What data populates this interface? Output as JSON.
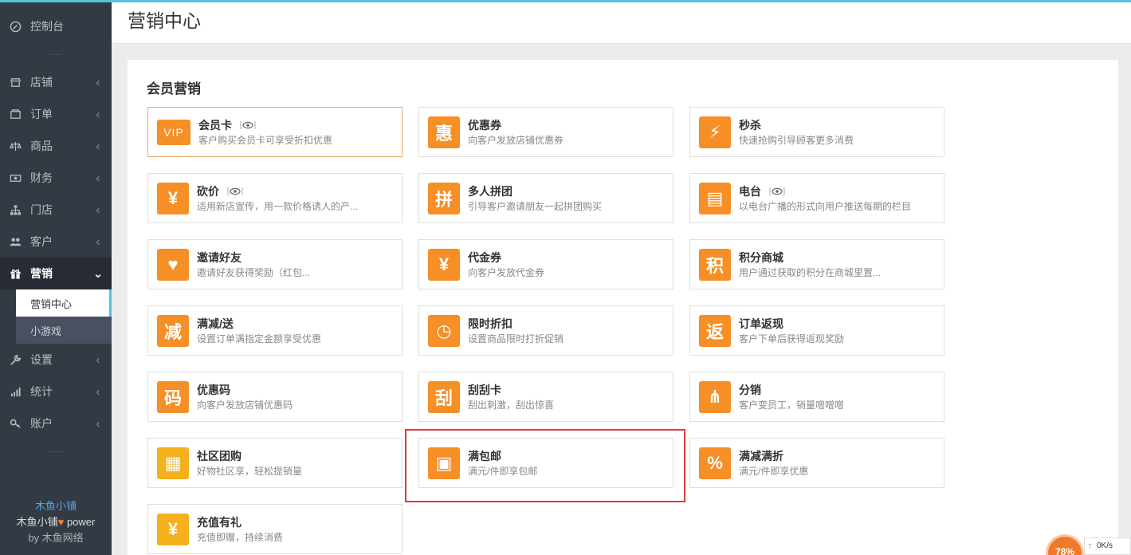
{
  "sidebar": {
    "top_item": {
      "label": "控制台",
      "icon": "dashboard-icon"
    },
    "items": [
      {
        "label": "店铺",
        "icon": "shop-icon"
      },
      {
        "label": "订单",
        "icon": "order-icon"
      },
      {
        "label": "商品",
        "icon": "scale-icon"
      },
      {
        "label": "财务",
        "icon": "money-icon"
      },
      {
        "label": "门店",
        "icon": "sitemap-icon"
      },
      {
        "label": "客户",
        "icon": "users-icon"
      },
      {
        "label": "营销",
        "icon": "gift-icon"
      },
      {
        "label": "设置",
        "icon": "wrench-icon"
      },
      {
        "label": "统计",
        "icon": "bar-chart-icon"
      },
      {
        "label": "账户",
        "icon": "key-icon"
      }
    ],
    "submenu": [
      {
        "label": "营销中心"
      },
      {
        "label": "小游戏"
      }
    ],
    "dots": "....",
    "brand": {
      "name": "木鱼小铺",
      "power_prefix": "木鱼小铺",
      "power_suffix": " power",
      "by": "by 木鱼网络"
    }
  },
  "header": {
    "title": "营销中心"
  },
  "section": {
    "title": "会员营销"
  },
  "cards": [
    {
      "title": "会员卡",
      "desc": "客户购买会员卡可享受折扣优惠",
      "icon": "vip-icon",
      "glyph": "VIP",
      "eye": true
    },
    {
      "title": "优惠券",
      "desc": "向客户发放店铺优惠券",
      "icon": "hui-icon",
      "glyph": "惠",
      "eye": false
    },
    {
      "title": "秒杀",
      "desc": "快速抢购引导顾客更多消费",
      "icon": "lightning-icon",
      "glyph": "⚡",
      "eye": false
    },
    {
      "title": "砍价",
      "desc": "适用新店宣传，用一款价格诱人的产...",
      "icon": "bargain-icon",
      "glyph": "¥",
      "eye": true
    },
    {
      "title": "多人拼团",
      "desc": "引导客户邀请朋友一起拼团购买",
      "icon": "group-buy-icon",
      "glyph": "拼",
      "eye": false
    },
    {
      "title": "电台",
      "desc": "以电台广播的形式向用户推送每期的栏目",
      "icon": "radio-icon",
      "glyph": "▤",
      "eye": true
    },
    {
      "title": "邀请好友",
      "desc": "邀请好友获得奖励（红包...",
      "icon": "invite-icon",
      "glyph": "♥",
      "eye": false
    },
    {
      "title": "代金券",
      "desc": "向客户发放代金券",
      "icon": "voucher-icon",
      "glyph": "¥",
      "eye": false
    },
    {
      "title": "积分商城",
      "desc": "用户通过获取的积分在商城里置...",
      "icon": "points-icon",
      "glyph": "积",
      "eye": false
    },
    {
      "title": "满减/送",
      "desc": "设置订单满指定金额享受优惠",
      "icon": "minus-icon",
      "glyph": "减",
      "eye": false
    },
    {
      "title": "限时折扣",
      "desc": "设置商品限时打折促销",
      "icon": "clock-icon",
      "glyph": "◷",
      "eye": false
    },
    {
      "title": "订单返现",
      "desc": "客户下单后获得返现奖励",
      "icon": "cashback-icon",
      "glyph": "返",
      "eye": false
    },
    {
      "title": "优惠码",
      "desc": "向客户发放店铺优惠码",
      "icon": "code-icon",
      "glyph": "码",
      "eye": false
    },
    {
      "title": "刮刮卡",
      "desc": "刮出刺激，刮出惊喜",
      "icon": "scratch-card-icon",
      "glyph": "刮",
      "eye": false
    },
    {
      "title": "分销",
      "desc": "客户变员工，销量噌噌噌",
      "icon": "distribution-icon",
      "glyph": "⋔",
      "eye": false
    },
    {
      "title": "社区团购",
      "desc": "好物社区享，轻松提销量",
      "icon": "building-icon",
      "glyph": "▦",
      "eye": false
    },
    {
      "title": "满包邮",
      "desc": "满元/件即享包邮",
      "icon": "package-icon",
      "glyph": "▣",
      "eye": false
    },
    {
      "title": "满减满折",
      "desc": "满元/件即享优惠",
      "icon": "percent-icon",
      "glyph": "%",
      "eye": false
    },
    {
      "title": "充值有礼",
      "desc": "充值即赠，持续消费",
      "icon": "money-bag-icon",
      "glyph": "¥",
      "eye": false
    }
  ],
  "speed_widget": {
    "percent": "78%",
    "rate": "0K/s"
  },
  "colors": {
    "accent": "#f58f26",
    "sidebar_bg": "#343a44",
    "highlight": "#52c5d8",
    "red_box": "#e03a3a"
  }
}
